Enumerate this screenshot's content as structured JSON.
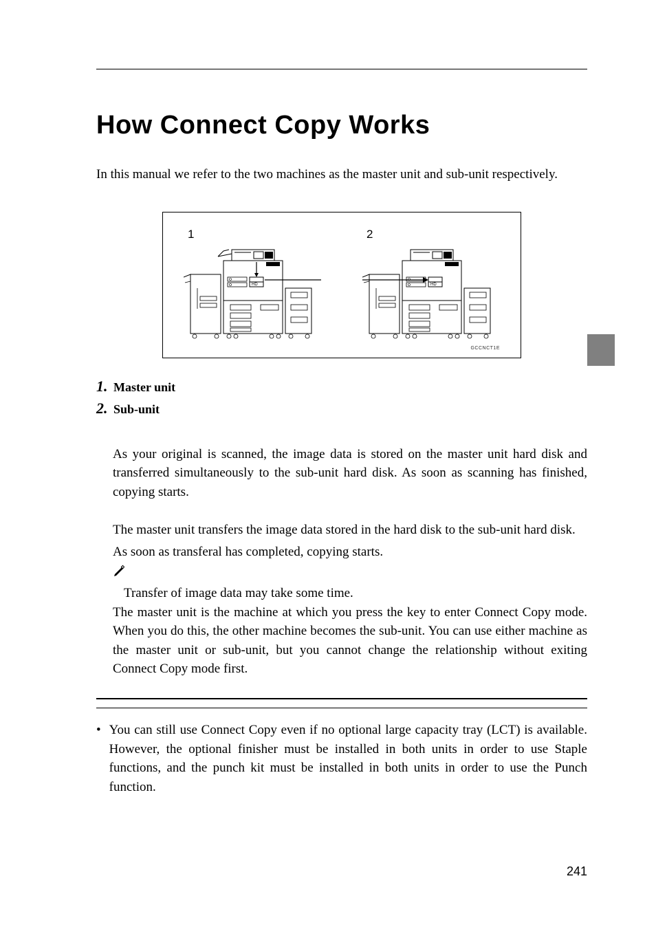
{
  "title": "How Connect Copy Works",
  "intro": "In this manual we refer to the two machines as the master unit and sub-unit respectively.",
  "figure": {
    "label1": "1",
    "label2": "2",
    "caption": "GCCNCT1E"
  },
  "legend": {
    "item1_num": "1.",
    "item1_label": "Master unit",
    "item2_num": "2.",
    "item2_label": "Sub-unit"
  },
  "scan_section": {
    "para": "As your original is scanned, the image data is stored on the master unit hard disk and transferred simultaneously to the sub-unit hard disk. As soon as scanning has finished, copying starts."
  },
  "memory_section": {
    "para1": "The master unit transfers the image data stored in the hard disk to the sub-unit hard disk.",
    "para2": "As soon as transferal has completed, copying starts.",
    "note": "Transfer of image data may take some time.",
    "after_a": "The master unit is the machine at which you press the ",
    "after_b": " key to enter Connect Copy mode. When you do this, the other machine becomes the sub-unit. You can use either machine as the master unit or sub-unit, but you cannot change the relationship without exiting Connect Copy mode first."
  },
  "bullet": "You can still use Connect Copy even if no optional large capacity tray (LCT) is available. However, the optional finisher must be installed in both units in order to use Staple functions, and the punch kit must be installed in both units in order to use the Punch function.",
  "page_number": "241"
}
